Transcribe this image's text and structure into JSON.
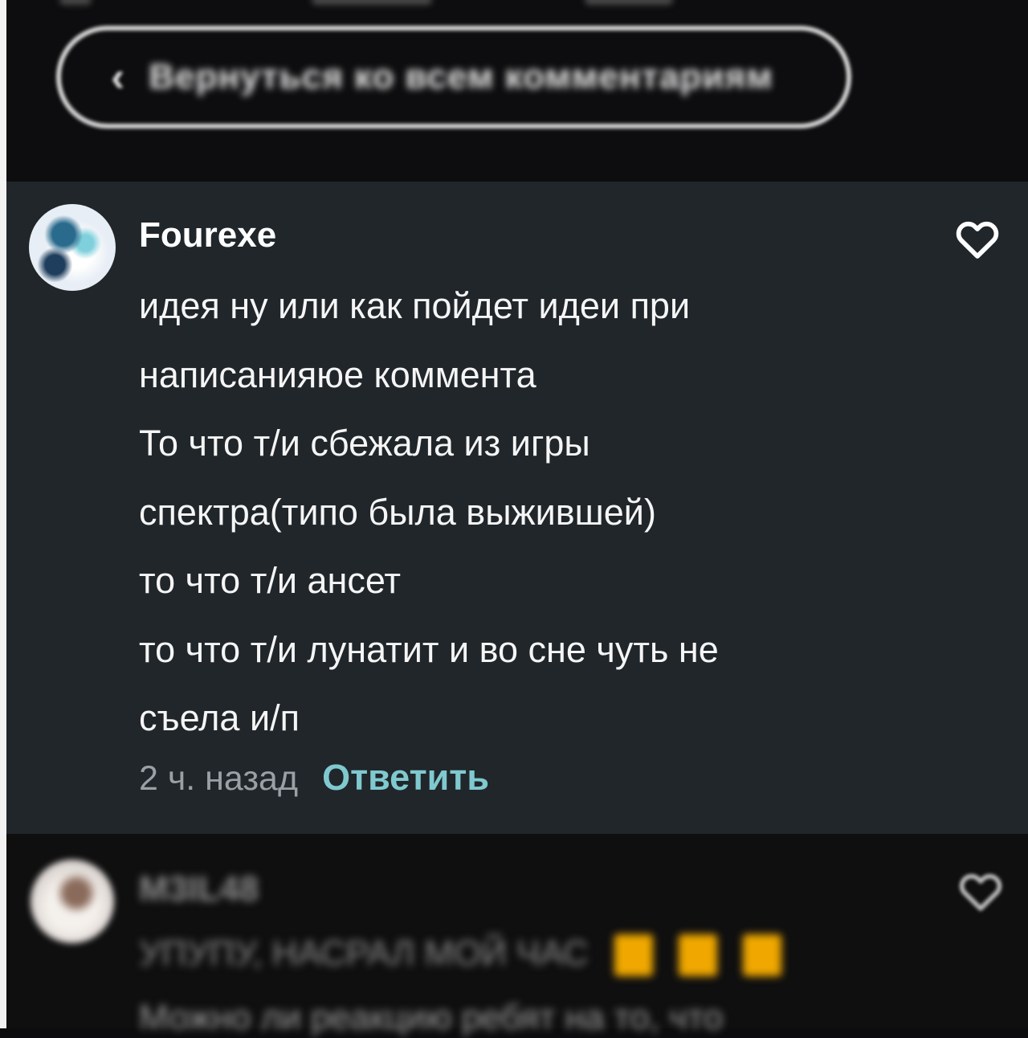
{
  "back_button": {
    "label": "Вернуться ко всем комментариям"
  },
  "comment": {
    "username": "Fourexe",
    "lines": [
      "идея ну или как пойдет идеи при",
      "написанияюе коммента",
      "То что т/и сбежала из игры",
      "спектра(типо была выжившей)",
      "то что т/и ансет",
      "то что т/и лунатит и во сне чуть не",
      "съела и/п"
    ],
    "timestamp": "2 ч. назад",
    "reply_label": "Ответить",
    "like_icon": "heart-outline-icon"
  },
  "next_comment": {
    "username": "М3ІL48",
    "text": "УПУПУ, НАСРАЛ МОЙ ЧАС",
    "text2": "Можно ли реакцию ребят на то, что"
  },
  "colors": {
    "comment_bg": "#20262a",
    "reply_accent": "#7fc9cf",
    "timestamp": "#9aa1a6"
  }
}
